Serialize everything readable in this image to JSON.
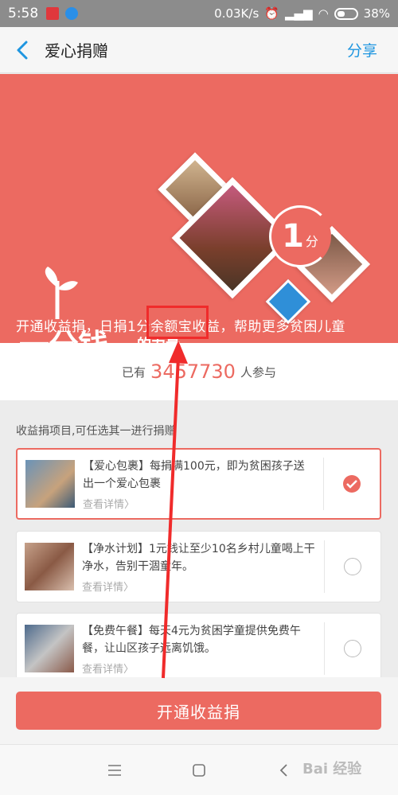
{
  "status_bar": {
    "time": "5:58",
    "network_speed": "0.03K/s",
    "battery": "38%"
  },
  "nav": {
    "title": "爱心捐赠",
    "share_label": "分享"
  },
  "banner": {
    "badge_number": "1",
    "badge_unit": "分",
    "slogan": "一分钱",
    "slogan_small": "的力量",
    "description": "开通收益捐，日捐1分余额宝收益，帮助更多贫困儿童"
  },
  "participants": {
    "prefix": "已有",
    "count": "3457730",
    "suffix": "人参与"
  },
  "section_label": "收益捐项目,可任选其一进行捐赠",
  "projects": [
    {
      "text": "【爱心包裹】每捐满100元，即为贫困孩子送出一个爱心包裹",
      "more": "查看详情",
      "selected": true
    },
    {
      "text": "【净水计划】1元钱让至少10名乡村儿童喝上干净水，告别干涸童年。",
      "more": "查看详情",
      "selected": false
    },
    {
      "text": "【免费午餐】每天4元为贫困学童提供免费午餐，让山区孩子远离饥饿。",
      "more": "查看详情",
      "selected": false
    }
  ],
  "cta_label": "开通收益捐",
  "watermark": "Bai 经验",
  "colors": {
    "brand_red": "#ec6a61",
    "link_blue": "#1f96e0",
    "annotation_red": "#f02b2b"
  }
}
